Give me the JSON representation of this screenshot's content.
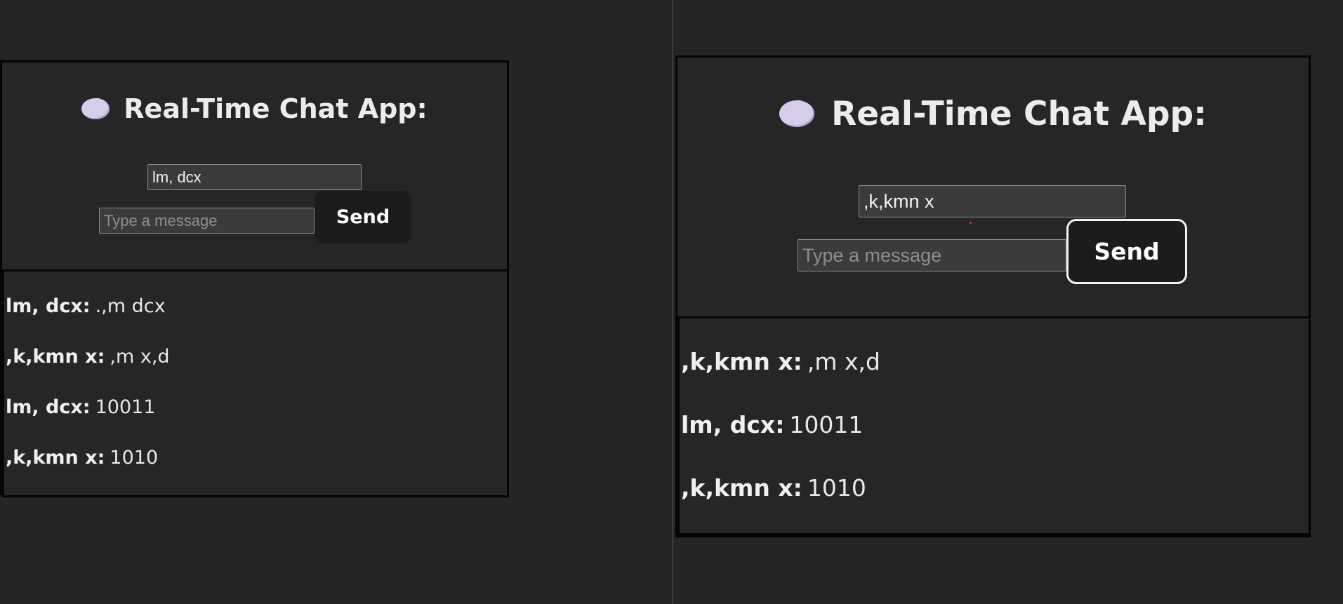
{
  "left_window": {
    "title": "Real-Time Chat App:",
    "icon": "speech-bubble-icon",
    "name_input_value": "lm, dcx",
    "message_placeholder": "Type a message",
    "send_label": "Send",
    "messages": [
      {
        "sender": "lm, dcx:",
        "text": ".,m dcx"
      },
      {
        "sender": ",k,kmn x:",
        "text": ",m x,d"
      },
      {
        "sender": "lm, dcx:",
        "text": "10011"
      },
      {
        "sender": ",k,kmn x:",
        "text": "1010"
      }
    ]
  },
  "right_window": {
    "title": "Real-Time Chat App:",
    "icon": "speech-bubble-icon",
    "name_input_value": ",k,kmn x",
    "message_placeholder": "Type a message",
    "send_label": "Send",
    "messages": [
      {
        "sender": ",k,kmn x:",
        "text": ",m x,d"
      },
      {
        "sender": "lm, dcx:",
        "text": "10011"
      },
      {
        "sender": ",k,kmn x:",
        "text": "1010"
      }
    ]
  },
  "colors": {
    "background": "#252525",
    "border": "#050505",
    "bubble": "#d7cdea",
    "send_button": "#1c1c1c",
    "cursor_dot": "#e23030"
  }
}
